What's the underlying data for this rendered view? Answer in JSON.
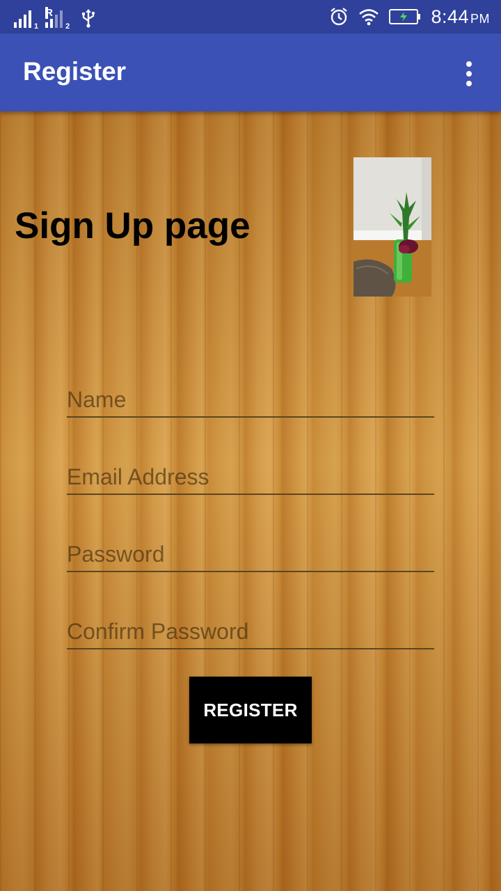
{
  "status_bar": {
    "sim1_index": "1",
    "roaming_indicator": "R",
    "sim2_index": "2",
    "time": "8:44",
    "ampm": "PM",
    "icons": [
      "signal-sim1-icon",
      "signal-sim2-icon",
      "usb-icon",
      "alarm-icon",
      "wifi-icon",
      "battery-charging-icon"
    ]
  },
  "app_bar": {
    "title": "Register",
    "menu_icon": "more-vert-icon"
  },
  "main": {
    "heading": "Sign Up page",
    "photo_alt": "photo of a plant in a green vase",
    "fields": {
      "name": {
        "placeholder": "Name",
        "value": ""
      },
      "email": {
        "placeholder": "Email Address",
        "value": ""
      },
      "password": {
        "placeholder": "Password",
        "value": ""
      },
      "confirm_password": {
        "placeholder": "Confirm Password",
        "value": ""
      }
    },
    "register_label": "REGISTER"
  },
  "colors": {
    "status_bar": "#2f419a",
    "app_bar": "#3b51b5",
    "button": "#000000",
    "wood": "#c98a3a"
  }
}
